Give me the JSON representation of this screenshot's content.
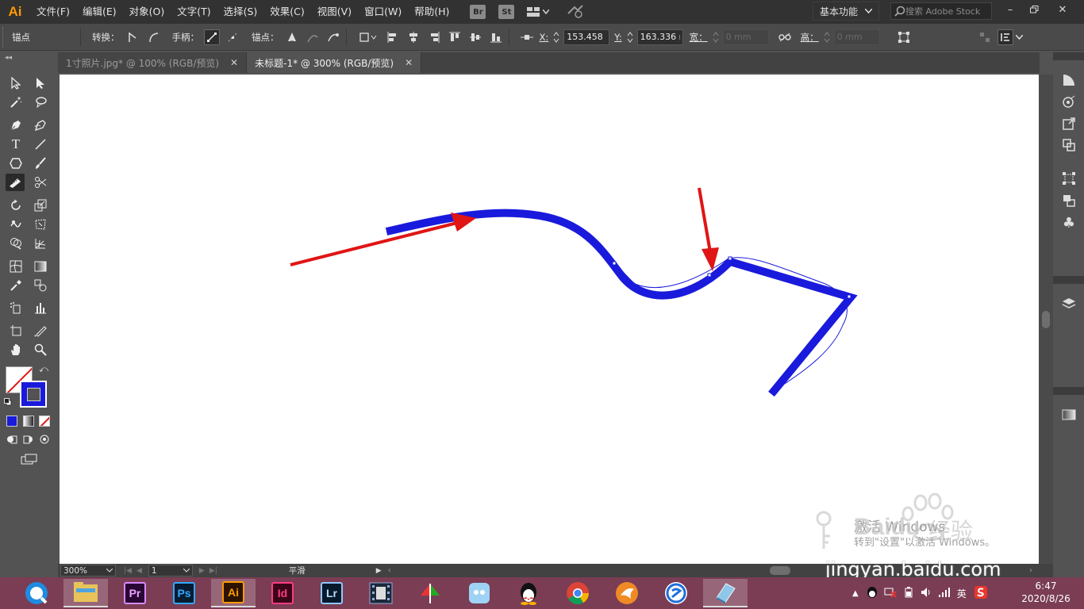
{
  "app": {
    "logo": "Ai",
    "menu": [
      "文件(F)",
      "编辑(E)",
      "对象(O)",
      "文字(T)",
      "选择(S)",
      "效果(C)",
      "视图(V)",
      "窗口(W)",
      "帮助(H)"
    ],
    "bridge": "Br",
    "stock": "St",
    "workspace": "基本功能",
    "search_placeholder": "搜索 Adobe Stock"
  },
  "controlbar": {
    "mode_label": "锚点",
    "convert_label": "转换：",
    "handle_label": "手柄：",
    "anchor_label": "锚点：",
    "x_label": "X:",
    "x_value": "153.458 m",
    "y_label": "Y:",
    "y_value": "163.336 m",
    "w_label": "宽：",
    "w_value": "0 mm",
    "h_label": "高：",
    "h_value": "0 mm"
  },
  "tabs": [
    {
      "label": "1寸照片.jpg* @ 100% (RGB/预览)",
      "active": false
    },
    {
      "label": "未标题-1* @ 300% (RGB/预览)",
      "active": true
    }
  ],
  "statusbar": {
    "zoom": "300%",
    "page": "1",
    "status_text": "平滑"
  },
  "canvas": {
    "path_color": "#1a1adc",
    "arrow_color": "#e01515"
  },
  "tray": {
    "ime": "英",
    "time": "6:47",
    "date": "2020/8/26"
  },
  "watermark": {
    "activate": "激活 Windows",
    "sub": "转到\"设置\"以激活 Windows。",
    "brand": "Baidu",
    "brand_cn": "经验",
    "site": "jingyan.baidu.com"
  },
  "taskbar_apps": [
    "Pr",
    "Ps",
    "Ai",
    "Id",
    "Lr"
  ]
}
